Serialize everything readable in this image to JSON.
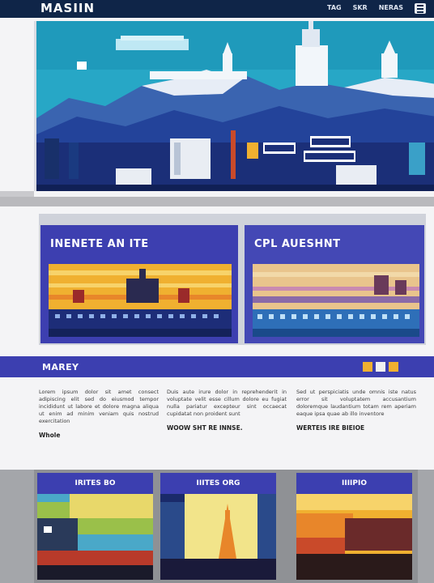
{
  "header": {
    "logo": "MASIIN",
    "nav": [
      "TAG",
      "SKR",
      "NERAS"
    ],
    "menu_icon": "hamburger-icon"
  },
  "promos": [
    {
      "title": "INENETE AN ITE"
    },
    {
      "title": "CPL AUESHNT"
    }
  ],
  "section": {
    "title": "MAREY",
    "badges": [
      "#f0b030",
      "#3c3fb0",
      "#f0b030"
    ]
  },
  "columns": [
    {
      "text": "Lorem ipsum dolor sit amet consect adipiscing elit sed do eiusmod tempor incididunt ut labore et dolore magna aliqua ut enim ad minim veniam quis nostrud exercitation",
      "more": "Whole"
    },
    {
      "text": "Duis aute irure dolor in reprehenderit in voluptate velit esse cillum dolore eu fugiat nulla pariatur excepteur sint occaecat cupidatat non proident sunt",
      "more": "WOOW SHT RE INNSE."
    },
    {
      "text": "Sed ut perspiciatis unde omnis iste natus error sit voluptatem accusantium doloremque laudantium totam rem aperiam eaque ipsa quae ab illo inventore",
      "more": "WERTEIS IRE BIEIOE"
    }
  ],
  "cards": [
    {
      "title": "IRITES BO"
    },
    {
      "title": "IIITES ORG"
    },
    {
      "title": "IIIIPIO"
    }
  ],
  "colors": {
    "nav": "#0f2548",
    "accent": "#3c3fb0",
    "sky": "#27a7c6",
    "orange": "#f0b030"
  }
}
